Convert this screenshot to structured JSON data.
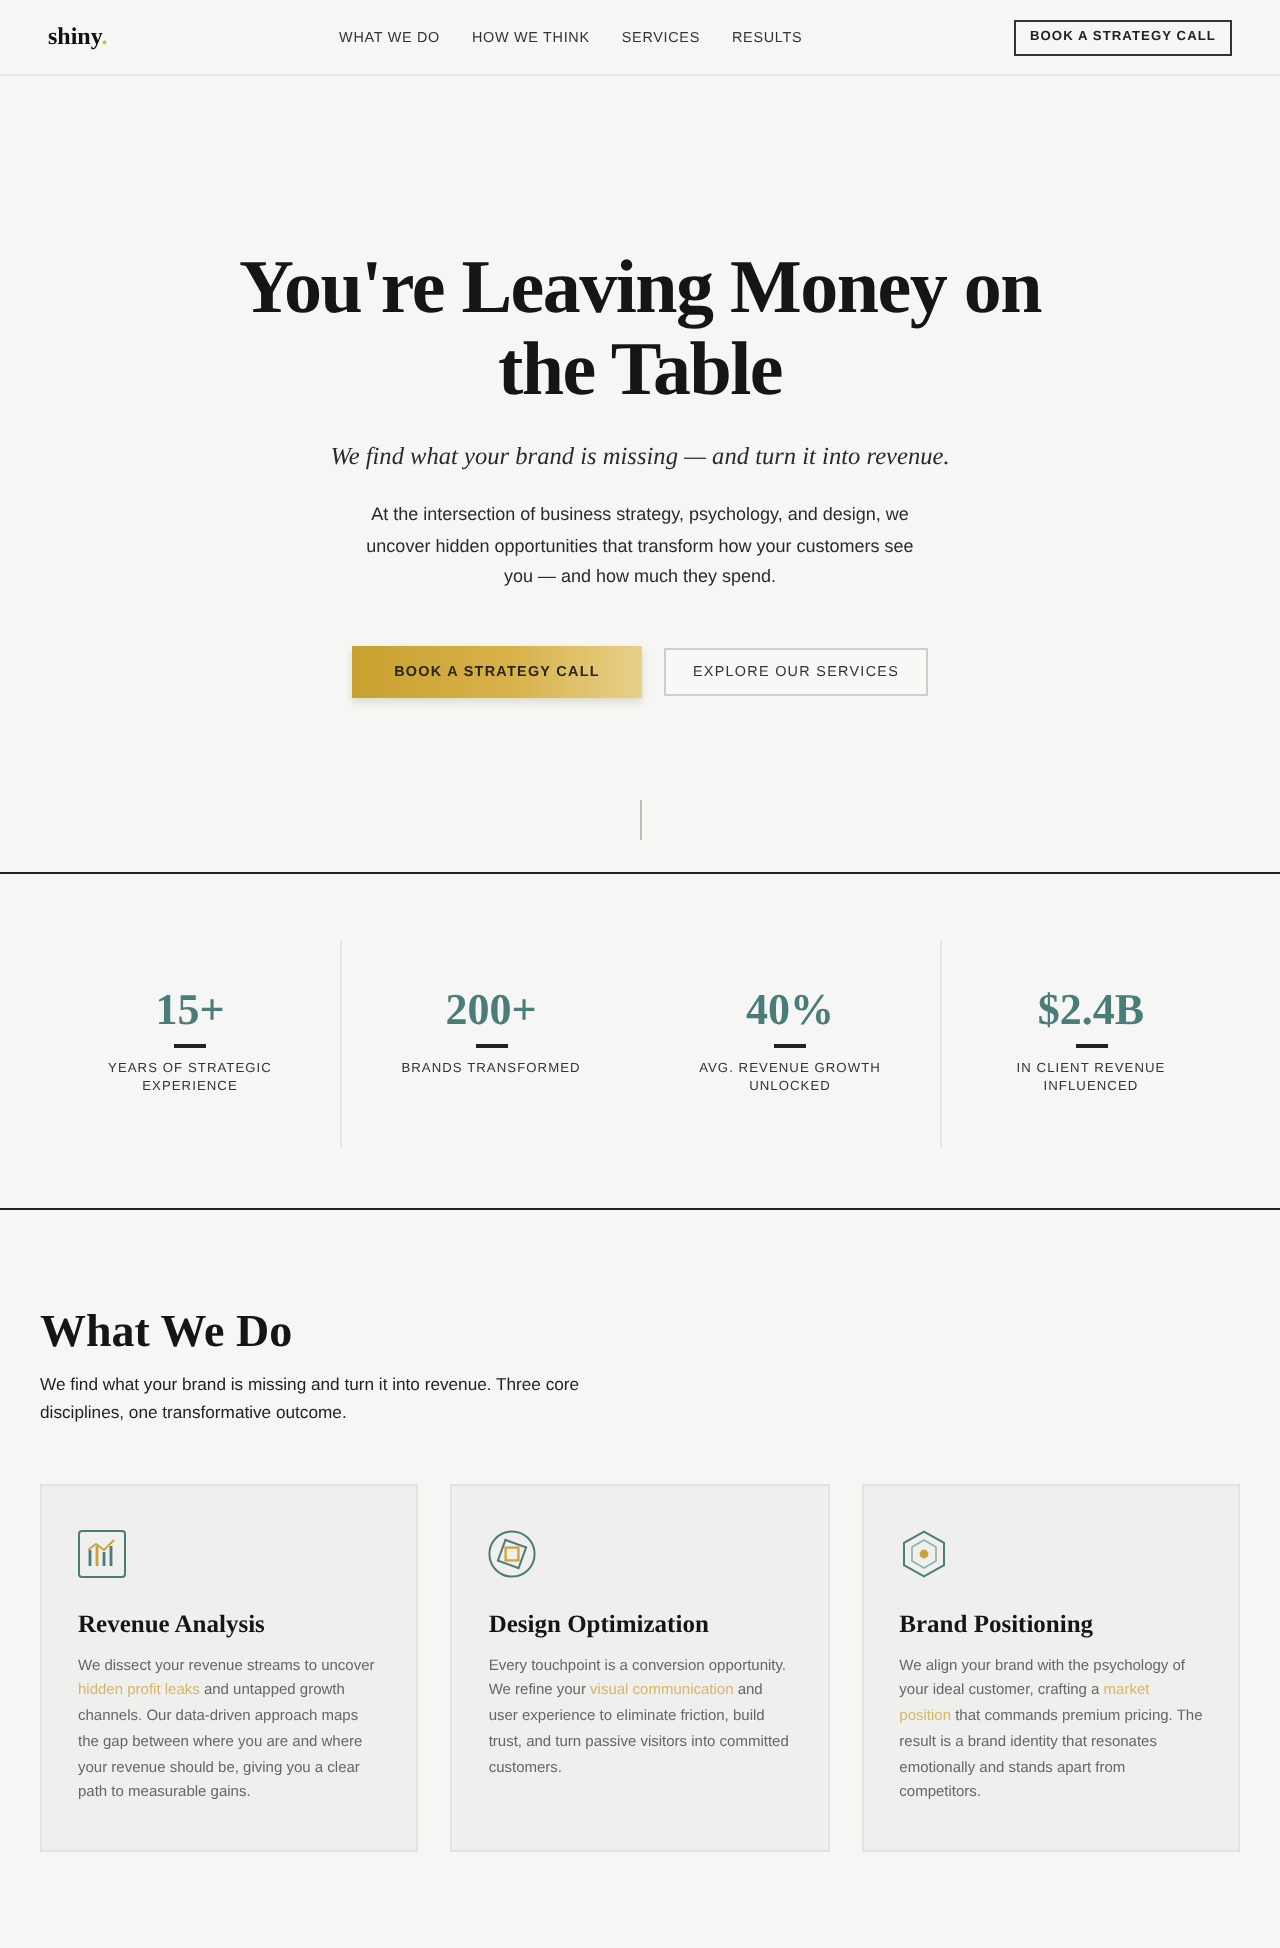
{
  "header": {
    "logo": {
      "text": "shiny",
      "accent": "."
    },
    "nav": [
      "WHAT WE DO",
      "HOW WE THINK",
      "SERVICES",
      "RESULTS"
    ],
    "cta": "BOOK A STRATEGY CALL"
  },
  "hero": {
    "title": "You're Leaving Money on the Table",
    "subtitle": "We find what your brand is missing — and turn it into revenue.",
    "body": "At the intersection of business strategy, psychology, and design, we uncover hidden opportunities that transform how your customers see you — and how much they spend.",
    "buttons": [
      {
        "label": "BOOK A STRATEGY CALL",
        "kind": "primary"
      },
      {
        "label": "EXPLORE OUR SERVICES",
        "kind": "secondary"
      }
    ]
  },
  "stats": [
    {
      "value": "15+",
      "label": "YEARS OF STRATEGIC EXPERIENCE"
    },
    {
      "value": "200+",
      "label": "BRANDS TRANSFORMED"
    },
    {
      "value": "40%",
      "label": "AVG. REVENUE GROWTH UNLOCKED"
    },
    {
      "value": "$2.4B",
      "label": "IN CLIENT REVENUE INFLUENCED"
    }
  ],
  "services": {
    "title": "What We Do",
    "intro": "We find what your brand is missing and turn it into revenue. Three core disciplines, one transformative outcome.",
    "cards": [
      {
        "title": "Revenue Analysis",
        "description": [
          {
            "text": "We dissect your revenue streams to uncover ",
            "highlight": false
          },
          {
            "text": "hidden profit leaks",
            "highlight": true
          },
          {
            "text": " and untapped growth channels. Our data-driven approach maps the gap between where you are and where your revenue should be, giving you a clear path to measurable gains.",
            "highlight": false
          }
        ]
      },
      {
        "title": "Design Optimization",
        "description": [
          {
            "text": "Every touchpoint is a conversion opportunity. We refine your ",
            "highlight": false
          },
          {
            "text": "visual communication",
            "highlight": true
          },
          {
            "text": " and user experience to eliminate friction, build trust, and turn passive visitors into committed customers.",
            "highlight": false
          }
        ]
      },
      {
        "title": "Brand Positioning",
        "description": [
          {
            "text": "We align your brand with the psychology of your ideal customer, crafting a ",
            "highlight": false
          },
          {
            "text": "market position",
            "highlight": true
          },
          {
            "text": " that commands premium pricing. The result is a brand identity that resonates emotionally and stands apart from competitors.",
            "highlight": false
          }
        ]
      }
    ]
  }
}
